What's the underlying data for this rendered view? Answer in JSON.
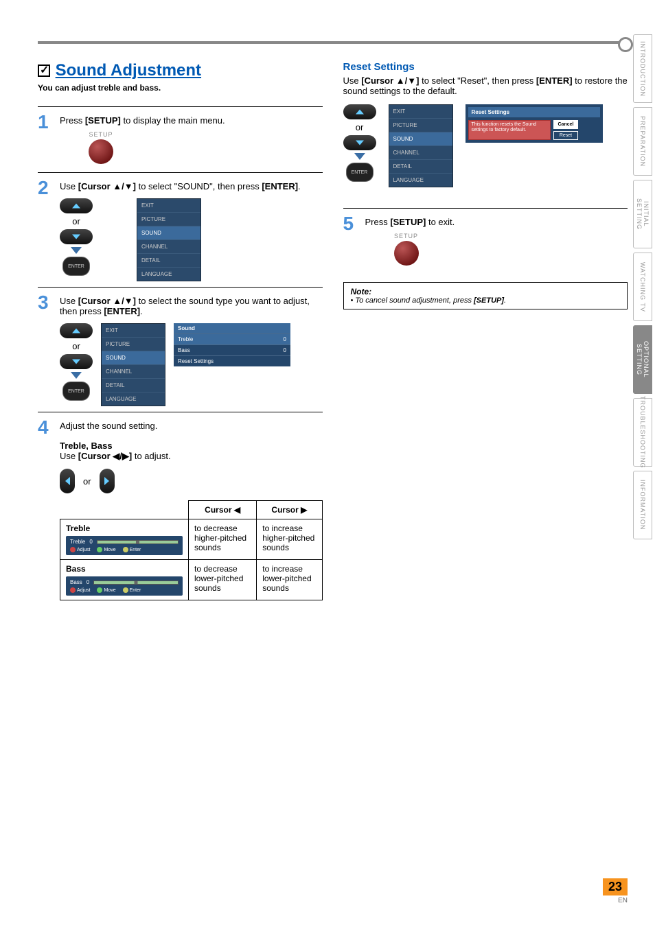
{
  "header": {
    "section_title": "Sound Adjustment",
    "section_sub": "You can adjust treble and bass."
  },
  "steps": {
    "s1": {
      "num": "1",
      "text_pre": "Press ",
      "setup": "[SETUP]",
      "text_post": " to display the main menu.",
      "setup_label": "SETUP"
    },
    "s2": {
      "num": "2",
      "text_pre": "Use ",
      "cursor": "[Cursor ▲/▼]",
      "text_mid": " to select \"SOUND\", then press ",
      "enter": "[ENTER]",
      "text_post": ".",
      "or": "or",
      "menu": [
        "EXIT",
        "PICTURE",
        "SOUND",
        "CHANNEL",
        "DETAIL",
        "LANGUAGE"
      ],
      "enter_btn": "ENTER"
    },
    "s3": {
      "num": "3",
      "text_pre": "Use ",
      "cursor": "[Cursor ▲/▼]",
      "text_mid": " to select the sound type you want to adjust, then press ",
      "enter": "[ENTER]",
      "text_post": ".",
      "or": "or",
      "menu": [
        "EXIT",
        "PICTURE",
        "SOUND",
        "CHANNEL",
        "DETAIL",
        "LANGUAGE"
      ],
      "panel_title": "Sound",
      "panel_rows": [
        {
          "label": "Treble",
          "val": "0"
        },
        {
          "label": "Bass",
          "val": "0"
        },
        {
          "label": "Reset Settings",
          "val": ""
        }
      ],
      "enter_btn": "ENTER"
    },
    "s4": {
      "num": "4",
      "text": "Adjust the sound setting.",
      "subhead": "Treble, Bass",
      "instr_pre": "Use ",
      "cursor": "[Cursor ◀/▶]",
      "instr_post": " to adjust.",
      "or": "or",
      "table": {
        "head_left": "Cursor ◀",
        "head_right": "Cursor ▶",
        "rows": [
          {
            "name": "Treble",
            "ui_label": "Treble",
            "ui_val": "0",
            "left": "to decrease higher-pitched sounds",
            "right": "to increase higher-pitched sounds"
          },
          {
            "name": "Bass",
            "ui_label": "Bass",
            "ui_val": "0",
            "left": "to decrease lower-pitched sounds",
            "right": "to increase lower-pitched sounds"
          }
        ],
        "controls": {
          "adjust": "Adjust",
          "move": "Move",
          "enter": "Enter"
        }
      }
    },
    "s5": {
      "num": "5",
      "text_pre": "Press ",
      "setup": "[SETUP]",
      "text_post": " to exit.",
      "setup_label": "SETUP"
    }
  },
  "reset": {
    "title": "Reset Settings",
    "text_pre": "Use ",
    "cursor": "[Cursor ▲/▼]",
    "text_mid": " to select \"Reset\", then press ",
    "enter": "[ENTER]",
    "text_post": " to restore the sound settings to the default.",
    "or": "or",
    "menu": [
      "EXIT",
      "PICTURE",
      "SOUND",
      "CHANNEL",
      "DETAIL",
      "LANGUAGE"
    ],
    "panel_title": "Reset Settings",
    "panel_msg": "This function resets the Sound settings to factory default.",
    "btn_cancel": "Cancel",
    "btn_reset": "Reset",
    "enter_btn": "ENTER"
  },
  "note": {
    "title": "Note:",
    "bullet": "• To cancel sound adjustment, press ",
    "setup": "[SETUP]",
    "post": "."
  },
  "tabs": [
    "INTRODUCTION",
    "PREPARATION",
    "INITIAL SETTING",
    "WATCHING TV",
    "OPTIONAL SETTING",
    "TROUBLESHOOTING",
    "INFORMATION"
  ],
  "tabs_active_index": 4,
  "page": {
    "num": "23",
    "en": "EN"
  }
}
